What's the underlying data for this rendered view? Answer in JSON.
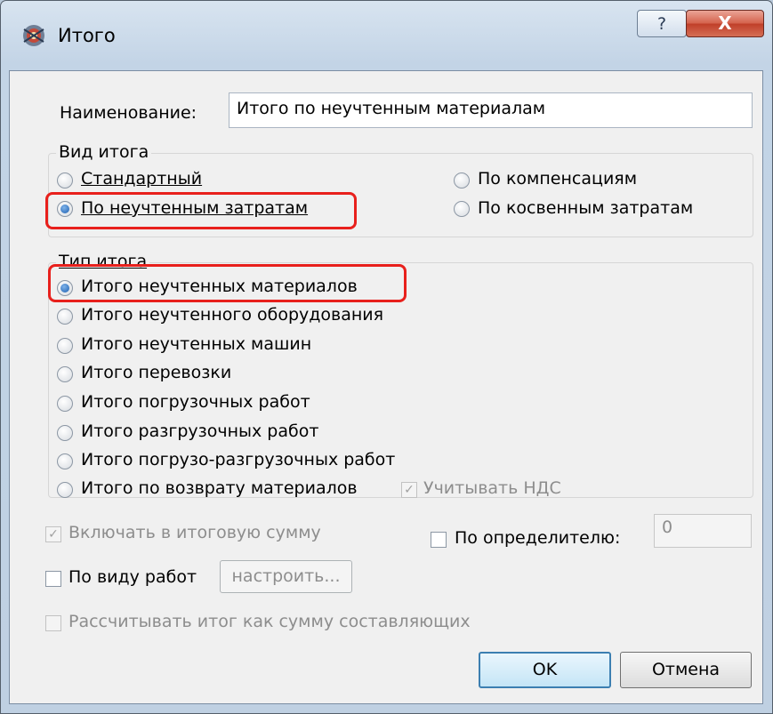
{
  "window": {
    "title": "Итого",
    "help_label": "?",
    "close_label": "X"
  },
  "name_field": {
    "label": "Наименование:",
    "value": "Итого по неучтенным материалам"
  },
  "total_kind": {
    "title": "Вид итога",
    "options": [
      {
        "label": "Стандартный",
        "selected": false
      },
      {
        "label": "По неучтенным затратам",
        "selected": true
      },
      {
        "label": "По компенсациям",
        "selected": false
      },
      {
        "label": "По косвенным затратам",
        "selected": false
      }
    ]
  },
  "total_type": {
    "title": "Тип итога",
    "options": [
      {
        "label": "Итого неучтенных материалов",
        "selected": true
      },
      {
        "label": "Итого неучтенного оборудования",
        "selected": false
      },
      {
        "label": "Итого неучтенных машин",
        "selected": false
      },
      {
        "label": "Итого перевозки",
        "selected": false
      },
      {
        "label": "Итого погрузочных работ",
        "selected": false
      },
      {
        "label": "Итого разгрузочных работ",
        "selected": false
      },
      {
        "label": "Итого погрузо-разгрузочных работ",
        "selected": false
      },
      {
        "label": "Итого по возврату материалов",
        "selected": false
      }
    ],
    "vat_check": {
      "label": "Учитывать НДС",
      "checked": true,
      "enabled": false
    }
  },
  "include_total": {
    "label": "Включать в итоговую сумму",
    "checked": true,
    "enabled": false
  },
  "by_determinant": {
    "label": "По определителю:",
    "checked": false,
    "value": "0"
  },
  "by_work_type": {
    "label": "По виду работ",
    "checked": false,
    "button_label": "настроить..."
  },
  "calc_as_sum": {
    "label": "Рассчитывать итог как сумму составляющих",
    "checked": false,
    "enabled": false
  },
  "buttons": {
    "ok": "OK",
    "cancel": "Отмена"
  },
  "check_glyph": "✓"
}
